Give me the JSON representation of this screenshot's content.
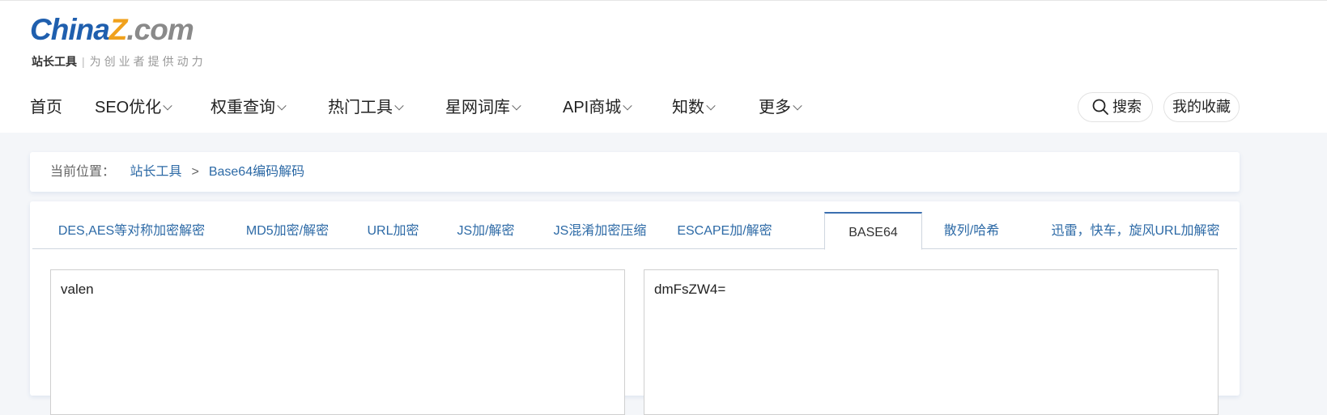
{
  "logo": {
    "word_part1": "China",
    "word_part2": "Z",
    "word_part3": ".com",
    "sub_title": "站长工具",
    "sub_sep": "|",
    "slogan": "为创业者提供动力"
  },
  "nav": {
    "items": [
      {
        "label": "首页"
      },
      {
        "label": "SEO优化"
      },
      {
        "label": "权重查询"
      },
      {
        "label": "热门工具"
      },
      {
        "label": "星网词库"
      },
      {
        "label": "API商城"
      },
      {
        "label": "知数"
      },
      {
        "label": "更多"
      }
    ],
    "search_label": "搜索",
    "favorites_label": "我的收藏"
  },
  "breadcrumb": {
    "prefix": "当前位置：",
    "items": [
      "站长工具",
      "Base64编码解码"
    ],
    "separator": ">"
  },
  "tabs": [
    {
      "label": "DES,AES等对称加密解密"
    },
    {
      "label": "MD5加密/解密"
    },
    {
      "label": "URL加密"
    },
    {
      "label": "JS加/解密"
    },
    {
      "label": "JS混淆加密压缩"
    },
    {
      "label": "ESCAPE加/解密"
    },
    {
      "label": "BASE64",
      "active": true
    },
    {
      "label": "散列/哈希"
    },
    {
      "label": "迅雷，快车，旋风URL加解密"
    }
  ],
  "editor": {
    "input_value": "valen",
    "output_value": "dmFsZW4="
  },
  "colors": {
    "brand_blue": "#1f5fae",
    "brand_orange": "#f0a11c",
    "link_blue": "#2d6aa6",
    "active_tab_border": "#3b6fb0"
  }
}
